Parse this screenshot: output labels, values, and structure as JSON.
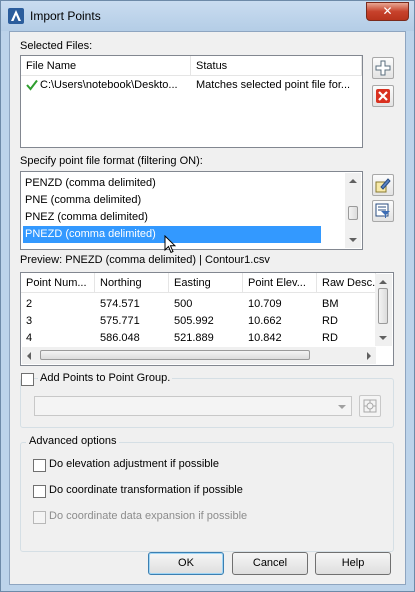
{
  "window": {
    "title": "Import Points",
    "close_glyph": "✕"
  },
  "selected_files": {
    "label": "Selected Files:",
    "columns": [
      "File Name",
      "Status"
    ],
    "rows": [
      {
        "file_name": "C:\\Users\\notebook\\Deskto...",
        "status": "Matches selected point file for..."
      }
    ]
  },
  "format": {
    "label": "Specify point file format (filtering ON):",
    "items": [
      "PENZD (comma delimited)",
      "PNE (comma delimited)",
      "PNEZ (comma delimited)",
      "PNEZD (comma delimited)"
    ],
    "selected": "PNEZD (comma delimited)"
  },
  "preview": {
    "label": "Preview: PNEZD (comma delimited) | Contour1.csv",
    "columns": [
      "Point Num...",
      "Northing",
      "Easting",
      "Point Elev...",
      "Raw Desc."
    ],
    "rows": [
      [
        "2",
        "574.571",
        "500",
        "10.709",
        "BM"
      ],
      [
        "3",
        "575.771",
        "505.992",
        "10.662",
        "RD"
      ],
      [
        "4",
        "586.048",
        "521.889",
        "10.842",
        "RD"
      ]
    ]
  },
  "point_group": {
    "label": "Add Points to Point Group.",
    "checked": false,
    "combo_value": ""
  },
  "advanced": {
    "title": "Advanced options",
    "options": [
      {
        "label": "Do elevation adjustment if possible",
        "checked": false,
        "enabled": true
      },
      {
        "label": "Do coordinate transformation if possible",
        "checked": false,
        "enabled": true
      },
      {
        "label": "Do coordinate data expansion if possible",
        "checked": false,
        "enabled": false
      }
    ]
  },
  "buttons": {
    "ok": "OK",
    "cancel": "Cancel",
    "help": "Help"
  },
  "colors": {
    "selection": "#3399ff",
    "title_bar": "#b9d1ea",
    "close": "#c7432b",
    "check": "#2e9e2e"
  }
}
